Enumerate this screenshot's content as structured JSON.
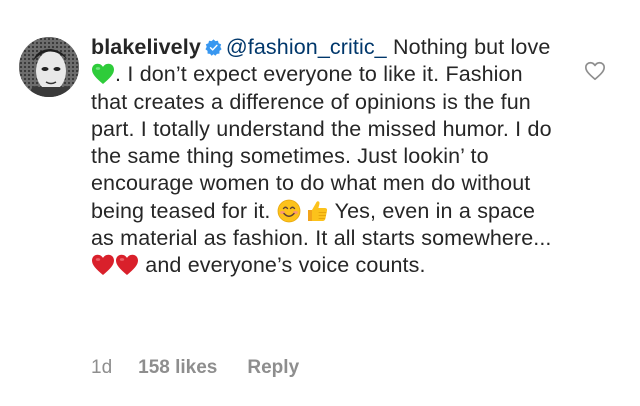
{
  "comment": {
    "username": "blakelively",
    "mention": "@fashion_critic_",
    "text_1": " Nothing but love ",
    "text_2": ". I don’t expect everyone to like it. Fashion that creates a difference of opinions is the fun part. I totally understand the missed humor. I do the same thing sometimes. Just lookin’ to encourage women to do what men do without being teased for it. ",
    "text_3": " Yes, even in a space as material as fashion. It all starts somewhere...",
    "text_4": " and everyone’s voice counts.",
    "emojis": [
      "green-heart-icon",
      "smiling-face-icon",
      "thumbs-up-icon",
      "red-heart-icon",
      "red-heart-icon"
    ]
  },
  "meta": {
    "time": "1d",
    "likes": "158 likes",
    "reply": "Reply"
  },
  "colors": {
    "text": "#262626",
    "mention": "#00376b",
    "meta": "#8e8e8e",
    "verified": "#3897f0"
  }
}
